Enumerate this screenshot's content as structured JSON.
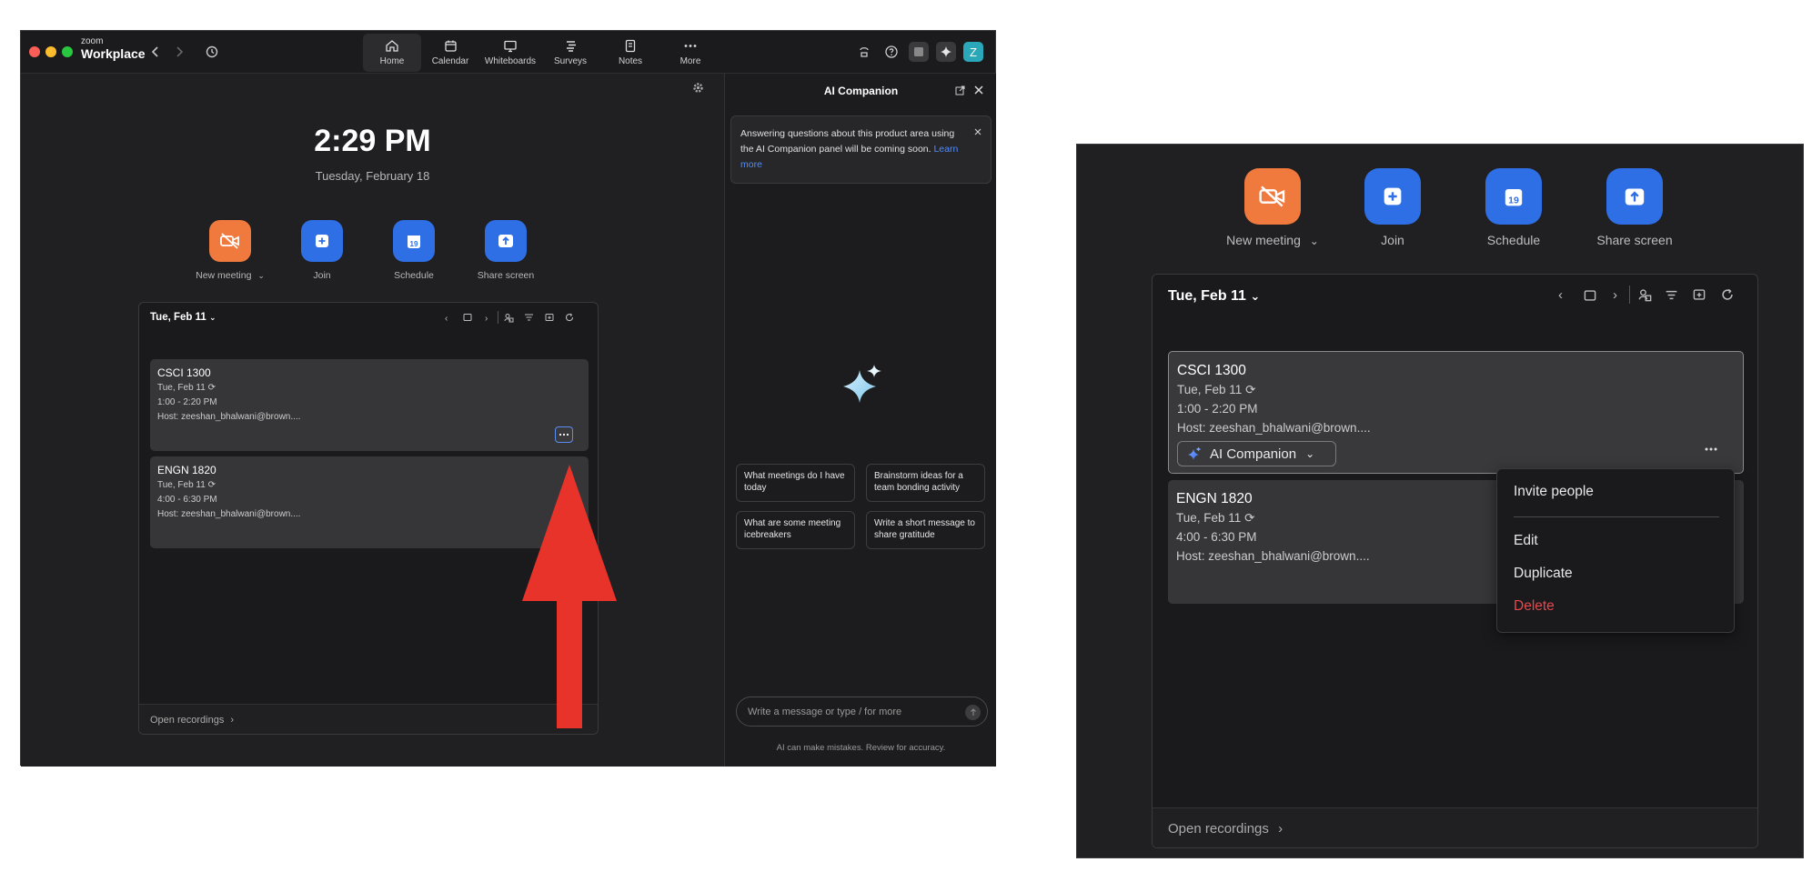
{
  "app": {
    "brand_small": "zoom",
    "brand_name": "Workplace"
  },
  "nav_tabs": [
    {
      "label": "Home",
      "icon": "home-icon",
      "active": true
    },
    {
      "label": "Calendar",
      "icon": "calendar-icon"
    },
    {
      "label": "Whiteboards",
      "icon": "whiteboard-icon"
    },
    {
      "label": "Surveys",
      "icon": "surveys-icon"
    },
    {
      "label": "Notes",
      "icon": "notes-icon"
    },
    {
      "label": "More",
      "icon": "more-icon"
    }
  ],
  "avatar_initial": "Z",
  "home": {
    "time": "2:29 PM",
    "date": "Tuesday, February 18",
    "actions": [
      {
        "label": "New meeting",
        "icon": "video-off-icon",
        "color": "#f07a3d"
      },
      {
        "label": "Join",
        "icon": "plus-icon",
        "color": "#2f6fe6"
      },
      {
        "label": "Schedule",
        "icon": "calendar-19-icon",
        "color": "#2f6fe6"
      },
      {
        "label": "Share screen",
        "icon": "share-up-icon",
        "color": "#2f6fe6"
      }
    ],
    "schedule_date": "Tue, Feb 11",
    "meetings": [
      {
        "title": "CSCI 1300",
        "date": "Tue, Feb 11",
        "time": "1:00 - 2:20 PM",
        "host": "Host: zeeshan_bhalwani@brown...."
      },
      {
        "title": "ENGN 1820",
        "date": "Tue, Feb 11",
        "time": "4:00 - 6:30 PM",
        "host": "Host: zeeshan_bhalwani@brown...."
      }
    ],
    "open_recordings": "Open recordings"
  },
  "ai_panel": {
    "title": "AI Companion",
    "notice": "Answering questions about this product area using the AI Companion panel will be coming soon.",
    "learn_more": "Learn more",
    "suggestions": [
      "What meetings do I have today",
      "Brainstorm ideas for a team bonding activity",
      "What are some meeting icebreakers",
      "Write a short message to share gratitude"
    ],
    "input_placeholder": "Write a message or type / for more",
    "disclaimer": "AI can make mistakes. Review for accuracy."
  },
  "zoomed": {
    "ai_companion_button": "AI Companion",
    "menu": [
      "Invite people",
      "Edit",
      "Duplicate",
      "Delete"
    ]
  },
  "colors": {
    "accent_blue": "#2f6fe6",
    "orange": "#f07a3d",
    "danger": "#e5484d",
    "annotation_arrow": "#e8332a"
  }
}
